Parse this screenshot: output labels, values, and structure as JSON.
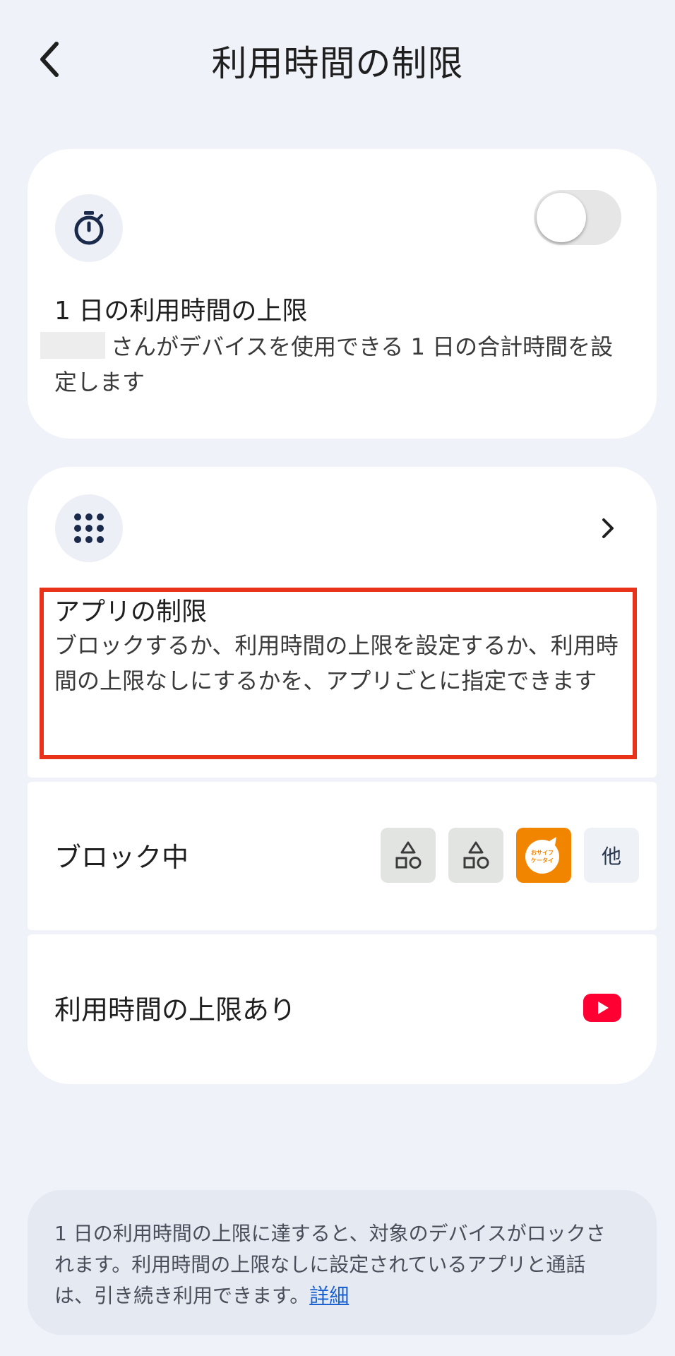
{
  "header": {
    "title": "利用時間の制限"
  },
  "daily_limit": {
    "title": "1 日の利用時間の上限",
    "description": "さんがデバイスを使用できる 1 日の合計時間を設定します",
    "toggle_on": false
  },
  "app_limits": {
    "title": "アプリの制限",
    "description": "ブロックするか、利用時間の上限を設定するか、利用時間の上限なしにするかを、アプリごとに指定できます"
  },
  "blocked": {
    "label": "ブロック中",
    "icons": [
      "apps-placeholder-icon",
      "apps-placeholder-icon",
      "osaifu-keitai-icon"
    ],
    "more_label": "他",
    "osaifu_label": "おサイフケータイ"
  },
  "limited": {
    "label": "利用時間の上限あり",
    "icons": [
      "youtube-icon"
    ]
  },
  "info": {
    "text": "1 日の利用時間の上限に達すると、対象のデバイスがロックされます。利用時間の上限なしに設定されているアプリと通話は、引き続き利用できます。",
    "link_label": "詳細"
  },
  "colors": {
    "background": "#eff2f8",
    "card": "#ffffff",
    "highlight": "#e9321a",
    "icon_navy": "#1b2a4a",
    "link": "#1a62d1",
    "osaifu_orange": "#f28500",
    "youtube_red": "#ff0033"
  }
}
